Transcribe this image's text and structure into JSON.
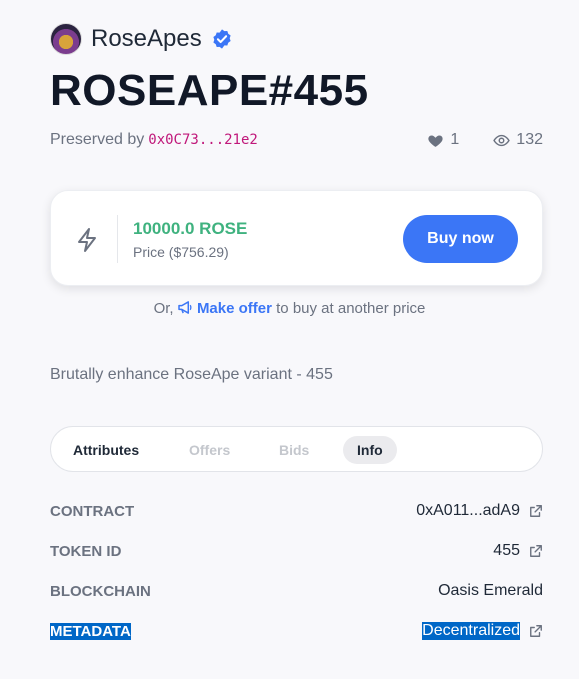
{
  "collection": {
    "name": "RoseApes"
  },
  "nft": {
    "title": "ROSEAPE#455"
  },
  "ownership": {
    "prefix": "Preserved by",
    "address": "0x0C73...21e2"
  },
  "stats": {
    "likes": "1",
    "views": "132"
  },
  "price": {
    "amount": "10000.0 ROSE",
    "fiat": "Price ($756.29)",
    "buy_label": "Buy now"
  },
  "offer": {
    "prefix": "Or,",
    "link": "Make offer",
    "suffix": "to buy at another price"
  },
  "description": "Brutally enhance RoseApe variant - 455",
  "tabs": [
    {
      "label": "Attributes"
    },
    {
      "label": "Offers"
    },
    {
      "label": "Bids"
    },
    {
      "label": "Info"
    }
  ],
  "info": [
    {
      "label": "CONTRACT",
      "value": "0xA011...adA9"
    },
    {
      "label": "TOKEN ID",
      "value": "455"
    },
    {
      "label": "BLOCKCHAIN",
      "value": "Oasis Emerald"
    },
    {
      "label": "METADATA",
      "value": "Decentralized"
    }
  ],
  "colors": {
    "accent": "#3b76f6",
    "price": "#3fb27f",
    "address": "#c0187a",
    "selection": "#0067c7"
  }
}
